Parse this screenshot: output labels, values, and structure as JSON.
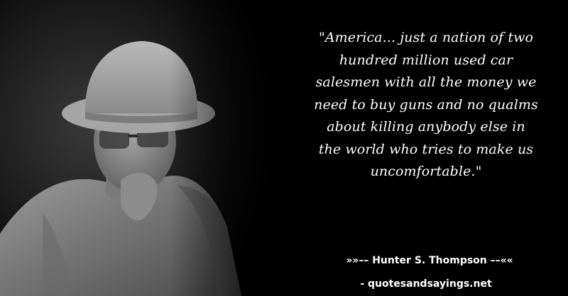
{
  "quote": {
    "lines": [
      "\"America... just a nation of two",
      "hundred million used car",
      "salesmen with all the money we",
      "need to buy guns and no qualms",
      "about killing anybody else in",
      "the world who tries to make us",
      "uncomfortable.\""
    ]
  },
  "attribution": "»»–– Hunter S. Thompson ––««",
  "source_site": "- quotesandsayings.net",
  "colors": {
    "background": "#000000",
    "text": "#ffffff"
  }
}
